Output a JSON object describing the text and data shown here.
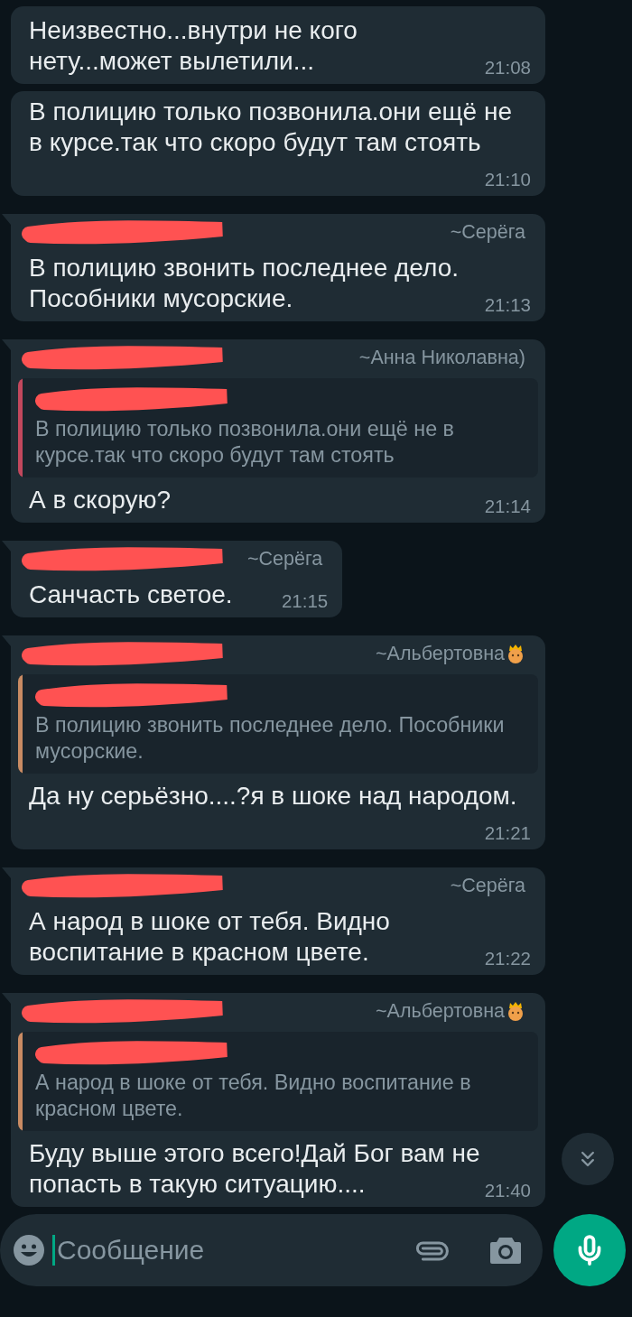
{
  "messages": [
    {
      "text": "Неизвестно...внутри не кого нету...может вылетили...",
      "time": "21:08"
    },
    {
      "text": "В полицию только позвонила.они ещё не в курсе.так что скоро будут там стоять",
      "time": "21:10"
    },
    {
      "sender": "~Серёга",
      "text": "В полицию звонить последнее дело. Пособники мусорские.",
      "time": "21:13"
    },
    {
      "sender": "~Анна Николавна)",
      "quote": {
        "text": "В полицию только позвонила.они ещё не в курсе.так что скоро будут там стоять",
        "color": "#c2485d"
      },
      "text": "А в скорую?",
      "time": "21:14"
    },
    {
      "sender": "~Серёга",
      "text": "Санчасть светое.",
      "time": "21:15"
    },
    {
      "sender": "~Альбертовна",
      "crown": true,
      "quote": {
        "text": "В полицию звонить последнее дело. Пособники мусорские.",
        "color": "#c98b63"
      },
      "text": "Да ну серьёзно....?я в шоке над народом.",
      "time": "21:21"
    },
    {
      "sender": "~Серёга",
      "text": "А народ в шоке от тебя. Видно воспитание в красном цвете.",
      "time": "21:22"
    },
    {
      "sender": "~Альбертовна",
      "crown": true,
      "quote": {
        "text": "А народ в шоке от тебя. Видно воспитание в красном цвете.",
        "color": "#c98b63"
      },
      "text": "Буду выше этого всего!Дай Бог вам не попасть в такую ситуацию....",
      "time": "21:40"
    }
  ],
  "composer": {
    "placeholder": "Сообщение"
  }
}
